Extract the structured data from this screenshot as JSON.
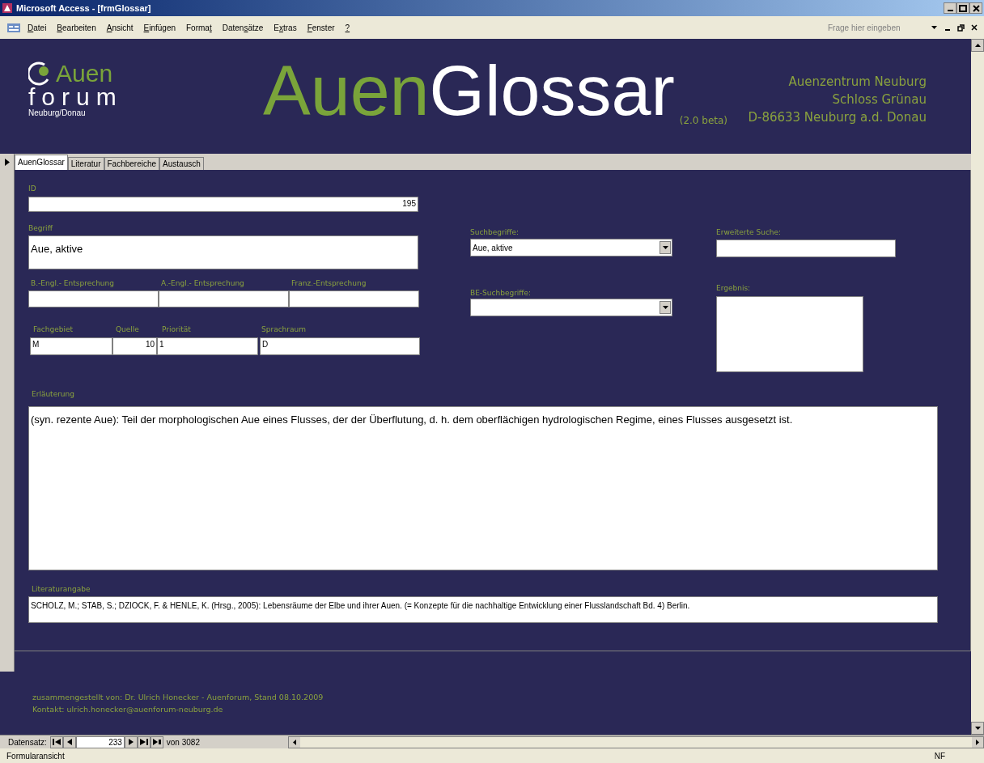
{
  "window": {
    "title": "Microsoft Access - [frmGlossar]"
  },
  "menu": [
    {
      "key": "D",
      "after": "atei"
    },
    {
      "key": "B",
      "after": "earbeiten"
    },
    {
      "key": "A",
      "after": "nsicht"
    },
    {
      "key": "E",
      "after": "infügen"
    },
    {
      "before": "Forma",
      "key": "t"
    },
    {
      "before": "Daten",
      "key": "s",
      "after": "ätze"
    },
    {
      "before": "E",
      "key": "x",
      "after": "tras"
    },
    {
      "key": "F",
      "after": "enster"
    },
    {
      "key": "?"
    }
  ],
  "help_box": {
    "placeholder": "Frage hier eingeben"
  },
  "header": {
    "logo": {
      "word": "Auen",
      "word2": "forum",
      "place": "Neuburg/Donau"
    },
    "title_part1": "Auen",
    "title_part2": "Glossar",
    "version": "(2.0 beta)",
    "address": [
      "Auenzentrum Neuburg",
      "Schloss Grünau",
      "D-86633 Neuburg a.d. Donau"
    ]
  },
  "tabs": [
    {
      "label": "AuenGlossar",
      "selected": true
    },
    {
      "label": "Literatur",
      "selected": false
    },
    {
      "label": "Fachbereiche",
      "selected": false
    },
    {
      "label": "Austausch",
      "selected": false
    }
  ],
  "form": {
    "id": {
      "label": "ID",
      "value": "195"
    },
    "begriff": {
      "label": "Begriff",
      "value": "Aue, aktive"
    },
    "b_engl": {
      "label": "B.-Engl.- Entsprechung"
    },
    "a_engl": {
      "label": "A.-Engl.- Entsprechung"
    },
    "franz": {
      "label": "Franz.-Entsprechung"
    },
    "fachgebiet": {
      "label": "Fachgebiet",
      "value": "M"
    },
    "quelle": {
      "label": "Quelle",
      "value": "10"
    },
    "prioritaet": {
      "label": "Priorität",
      "value": "1"
    },
    "sprachraum": {
      "label": "Sprachraum",
      "value": "D"
    },
    "suchbegriffe": {
      "label": "Suchbegriffe:",
      "value": "Aue, aktive"
    },
    "be_suchbegriffe": {
      "label": "BE-Suchbegriffe:"
    },
    "erweiterte_suche": {
      "label": "Erweiterte Suche:"
    },
    "ergebnis": {
      "label": "Ergebnis:"
    },
    "erlaeuterung": {
      "label": "Erläuterung",
      "value": "(syn. rezente Aue): Teil der morphologischen Aue eines Flusses, der der Überflutung, d. h. dem oberflächigen hydrologischen Regime, eines Flusses ausgesetzt ist."
    },
    "literatur": {
      "label": "Literaturangabe",
      "value": "SCHOLZ, M.; STAB, S.; DZIOCK, F. & HENLE, K. (Hrsg., 2005): Lebensräume der Elbe und ihrer Auen. (= Konzepte für die nachhaltige Entwicklung einer Flusslandschaft Bd. 4) Berlin."
    }
  },
  "footer": [
    "zusammengestellt von: Dr. Ulrich Honecker - Auenforum, Stand 08.10.2009",
    "Kontakt: ulrich.honecker@auenforum-neuburg.de"
  ],
  "navigation": {
    "label": "Datensatz:",
    "record": "233",
    "of": "von",
    "total": "3082"
  },
  "status_bar": {
    "view": "Formularansicht",
    "indicator": "NF"
  }
}
